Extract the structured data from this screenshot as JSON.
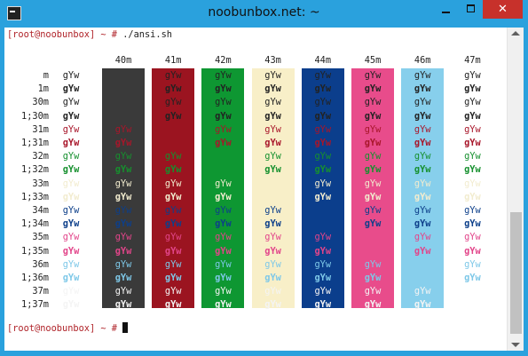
{
  "window": {
    "title": "noobunbox.net: ~",
    "close_glyph": "✕",
    "icon": "terminal-icon",
    "frame_color": "#2aa1dd"
  },
  "terminal": {
    "prompt": "[root@noobunbox] ~ # ",
    "command": "./ansi.sh",
    "final_prompt": "[root@noobunbox] ~ # ",
    "prompt_color": "#b0242a"
  },
  "table": {
    "sample_text": "gYw",
    "bg_headers": [
      "40m",
      "41m",
      "42m",
      "43m",
      "44m",
      "45m",
      "46m",
      "47m"
    ],
    "bg_colors": [
      "#3a3a3a",
      "#9b1420",
      "#0e9732",
      "#f8efc8",
      "#0b3e8c",
      "#e84c8b",
      "#87cfec",
      "#ffffff"
    ],
    "rows": [
      {
        "label": "m",
        "color": "#222222",
        "bold": false
      },
      {
        "label": "1m",
        "color": "#222222",
        "bold": true
      },
      {
        "label": "30m",
        "color": "#222222",
        "bold": false
      },
      {
        "label": "1;30m",
        "color": "#222222",
        "bold": true
      },
      {
        "label": "31m",
        "color": "#a8162a",
        "bold": false
      },
      {
        "label": "1;31m",
        "color": "#a8162a",
        "bold": true
      },
      {
        "label": "32m",
        "color": "#16902e",
        "bold": false
      },
      {
        "label": "1;32m",
        "color": "#16902e",
        "bold": true
      },
      {
        "label": "33m",
        "color": "#f2eccf",
        "bold": false
      },
      {
        "label": "1;33m",
        "color": "#f2eccf",
        "bold": true
      },
      {
        "label": "34m",
        "color": "#0d3f8a",
        "bold": false
      },
      {
        "label": "1;34m",
        "color": "#0d3f8a",
        "bold": true
      },
      {
        "label": "35m",
        "color": "#e2458a",
        "bold": false
      },
      {
        "label": "1;35m",
        "color": "#e2458a",
        "bold": true
      },
      {
        "label": "36m",
        "color": "#7ec8e8",
        "bold": false
      },
      {
        "label": "1;36m",
        "color": "#7ec8e8",
        "bold": true
      },
      {
        "label": "37m",
        "color": "#f4f4f4",
        "bold": false
      },
      {
        "label": "1;37m",
        "color": "#f4f4f4",
        "bold": true
      }
    ]
  }
}
